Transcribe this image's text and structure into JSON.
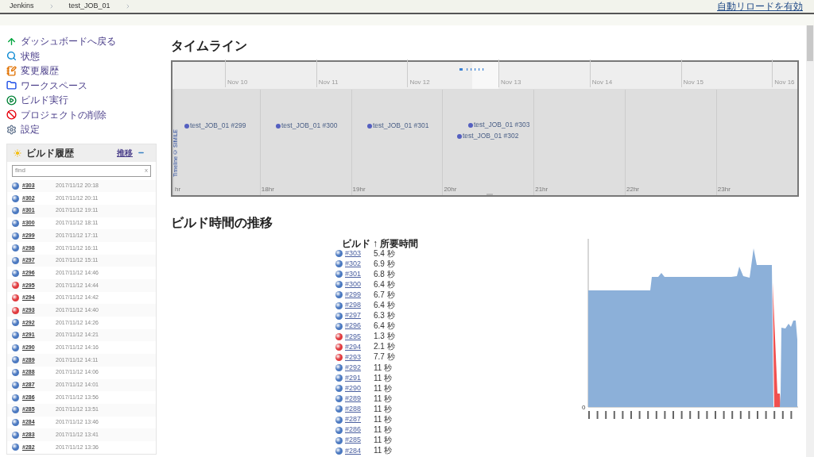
{
  "breadcrumbs": [
    {
      "label": "Jenkins"
    },
    {
      "label": "test_JOB_01"
    }
  ],
  "auto_reload_link": "自動リロードを有効",
  "sidebar": {
    "items": [
      {
        "label": "ダッシュボードへ戻る"
      },
      {
        "label": "状態"
      },
      {
        "label": "変更履歴"
      },
      {
        "label": "ワークスペース"
      },
      {
        "label": "ビルド実行"
      },
      {
        "label": "プロジェクトの削除"
      },
      {
        "label": "設定"
      }
    ]
  },
  "build_history": {
    "title": "ビルド履歴",
    "trend_link": "推移",
    "search": {
      "placeholder": "find",
      "clear": "x"
    },
    "rows": [
      {
        "number": "#303",
        "time": "2017/11/12 20:18",
        "color": "#4a78c0"
      },
      {
        "number": "#302",
        "time": "2017/11/12 20:11",
        "color": "#4a78c0"
      },
      {
        "number": "#301",
        "time": "2017/11/12 19:11",
        "color": "#4a78c0"
      },
      {
        "number": "#300",
        "time": "2017/11/12 18:11",
        "color": "#4a78c0"
      },
      {
        "number": "#299",
        "time": "2017/11/12 17:11",
        "color": "#4a78c0"
      },
      {
        "number": "#298",
        "time": "2017/11/12 16:11",
        "color": "#4a78c0"
      },
      {
        "number": "#297",
        "time": "2017/11/12 15:11",
        "color": "#4a78c0"
      },
      {
        "number": "#296",
        "time": "2017/11/12 14:46",
        "color": "#4a78c0"
      },
      {
        "number": "#295",
        "time": "2017/11/12 14:44",
        "color": "#e03a3e"
      },
      {
        "number": "#294",
        "time": "2017/11/12 14:42",
        "color": "#e03a3e"
      },
      {
        "number": "#293",
        "time": "2017/11/12 14:40",
        "color": "#e03a3e"
      },
      {
        "number": "#292",
        "time": "2017/11/12 14:26",
        "color": "#4a78c0"
      },
      {
        "number": "#291",
        "time": "2017/11/12 14:21",
        "color": "#4a78c0"
      },
      {
        "number": "#290",
        "time": "2017/11/12 14:16",
        "color": "#4a78c0"
      },
      {
        "number": "#289",
        "time": "2017/11/12 14:11",
        "color": "#4a78c0"
      },
      {
        "number": "#288",
        "time": "2017/11/12 14:06",
        "color": "#4a78c0"
      },
      {
        "number": "#287",
        "time": "2017/11/12 14:01",
        "color": "#4a78c0"
      },
      {
        "number": "#286",
        "time": "2017/11/12 13:56",
        "color": "#4a78c0"
      },
      {
        "number": "#285",
        "time": "2017/11/12 13:51",
        "color": "#4a78c0"
      },
      {
        "number": "#284",
        "time": "2017/11/12 13:46",
        "color": "#4a78c0"
      },
      {
        "number": "#283",
        "time": "2017/11/12 13:41",
        "color": "#4a78c0"
      },
      {
        "number": "#282",
        "time": "2017/11/12 13:36",
        "color": "#4a78c0"
      }
    ]
  },
  "timeline": {
    "title": "タイムライン",
    "credit": "Timeline © SIMILE",
    "dates": [
      "Nov 10",
      "Nov 11",
      "Nov 12",
      "Nov 13",
      "Nov 14",
      "Nov 15",
      "Nov 16"
    ],
    "hours": [
      "hr",
      "18hr",
      "19hr",
      "20hr",
      "21hr",
      "22hr",
      "23hr"
    ],
    "events": [
      {
        "label": "test_JOB_01 #299"
      },
      {
        "label": "test_JOB_01 #300"
      },
      {
        "label": "test_JOB_01 #301"
      },
      {
        "label": "test_JOB_01 #303"
      },
      {
        "label": "test_JOB_01 #302"
      }
    ]
  },
  "build_time_trend": {
    "title": "ビルド時間の推移",
    "sort_arrow": "↑",
    "columns": [
      "ビルド",
      "所要時間"
    ],
    "rows": [
      {
        "number": "#303",
        "duration": "5.4 秒",
        "color": "#4a78c0"
      },
      {
        "number": "#302",
        "duration": "6.9 秒",
        "color": "#4a78c0"
      },
      {
        "number": "#301",
        "duration": "6.8 秒",
        "color": "#4a78c0"
      },
      {
        "number": "#300",
        "duration": "6.4 秒",
        "color": "#4a78c0"
      },
      {
        "number": "#299",
        "duration": "6.7 秒",
        "color": "#4a78c0"
      },
      {
        "number": "#298",
        "duration": "6.4 秒",
        "color": "#4a78c0"
      },
      {
        "number": "#297",
        "duration": "6.3 秒",
        "color": "#4a78c0"
      },
      {
        "number": "#296",
        "duration": "6.4 秒",
        "color": "#4a78c0"
      },
      {
        "number": "#295",
        "duration": "1.3 秒",
        "color": "#e03a3e"
      },
      {
        "number": "#294",
        "duration": "2.1 秒",
        "color": "#e03a3e"
      },
      {
        "number": "#293",
        "duration": "7.7 秒",
        "color": "#e03a3e"
      },
      {
        "number": "#292",
        "duration": "11 秒",
        "color": "#4a78c0"
      },
      {
        "number": "#291",
        "duration": "11 秒",
        "color": "#4a78c0"
      },
      {
        "number": "#290",
        "duration": "11 秒",
        "color": "#4a78c0"
      },
      {
        "number": "#289",
        "duration": "11 秒",
        "color": "#4a78c0"
      },
      {
        "number": "#288",
        "duration": "11 秒",
        "color": "#4a78c0"
      },
      {
        "number": "#287",
        "duration": "11 秒",
        "color": "#4a78c0"
      },
      {
        "number": "#286",
        "duration": "11 秒",
        "color": "#4a78c0"
      },
      {
        "number": "#285",
        "duration": "11 秒",
        "color": "#4a78c0"
      },
      {
        "number": "#284",
        "duration": "11 秒",
        "color": "#4a78c0"
      }
    ],
    "chart_zero_label": "0"
  }
}
